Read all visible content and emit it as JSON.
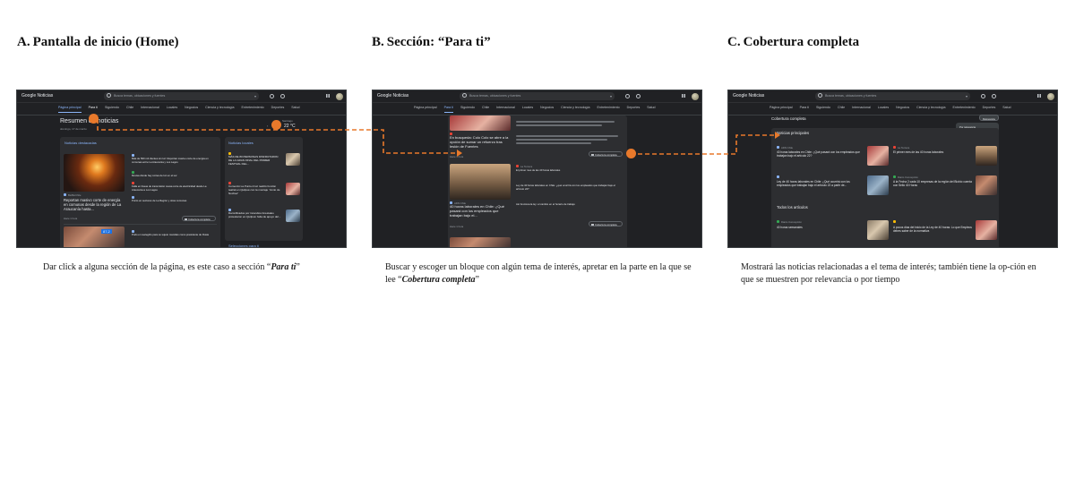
{
  "colors": {
    "accent_orange": "#e8792b",
    "screen_bg": "#202124",
    "link_blue": "#8ab4f8"
  },
  "panels": [
    {
      "letter": "A.",
      "title": "Pantalla de inicio (Home)",
      "caption_before": "Dar click a alguna sección de la página, es este caso a sección “",
      "caption_emph": "Para ti",
      "caption_after": "”"
    },
    {
      "letter": "B.",
      "title": "Sección: “Para ti”",
      "caption_before": "Buscar y escoger un bloque con algún tema de interés, apretar en la parte en la que se lee “",
      "caption_emph": "Cobertura completa",
      "caption_after": "”"
    },
    {
      "letter": "C.",
      "title": "Cobertura completa",
      "caption_before": "Mostrará las noticias relacionadas a el tema de interés; también tiene la op-ción en que se muestren por relevancia o por tiempo",
      "caption_emph": "",
      "caption_after": ""
    }
  ],
  "app": {
    "name": "Google Noticias",
    "search_placeholder": "Busca temas, ubicaciones y fuentes",
    "nav": [
      "Página principal",
      "Para ti",
      "Siguiendo",
      "Chile",
      "Internacional",
      "Locales",
      "Negocios",
      "Ciencia y tecnología",
      "Entretenimiento",
      "Deportes",
      "Salud"
    ]
  },
  "screen_a": {
    "heading": "Resumen de noticias",
    "date": "domingo, 17 de marzo",
    "weather_place": "Santiago",
    "temperature": "22 °C",
    "highlights": "Noticias destacadas",
    "local": "Noticias locales",
    "main_headline": "Reportan masivo corte de energía en comunas desde la región de La Araucanía hasta...",
    "main_source": "BioBioChile",
    "main_time": "Hace 1 hora",
    "full_coverage": "Cobertura completa",
    "badge": "87,2",
    "sections_label": "Selecciones para ti",
    "local_items": [
      "MÁS DE 80 PERSONAS DISFRUTARON DE LA GRAN FINAL DEL PRIMER FESTIVAL DEL...",
      "Comenzó La Punto-Cruz realizó función teatral en Quilpué con la montaje “Junto de Noches”",
      "Damnificados por incendios forestales protestaron en Quilpué: falta de apoyo del..."
    ],
    "side_items": [
      "Más de 500 mil clientes sin luz: Reportan masivo corte de energía en comunas entre La Araucanía y Los Lagos",
      "Revisa dónde hay cortes de luz en el sur",
      "Falla en líneas de transmisión causa corte de electricidad desde La Araucanía a Los Lagos",
      "Punto en sectores de La Región y otras comunas",
      "Pudo en reelegirlo para su sujeto mandato como presidente de Rusia"
    ]
  },
  "screen_b": {
    "headline_1": "En busqueda: Colo Colo se abre a la opción de sumar un refuerzo tras lesión de Fuentes",
    "headline_2": "40 horas laborales en Chile: ¿Qué pasará con los empleados que trabajan bajo el...",
    "source_1": "La Tercera",
    "source_2": "ADN Chile",
    "time": "Hace 1 hora",
    "full_coverage": "Cobertura completa",
    "side_items": [
      "El primer mes de las 40 horas laborales",
      "Ley de 40 horas laborales en Chile: ¿qué ocurrirá con los empleados que trabajan bajo el artículo 22?",
      "Así funciona la ley: el cambio en el horario de trabajo"
    ]
  },
  "screen_c": {
    "heading": "Cobertura completa",
    "top_news": "Noticias principales",
    "all_articles": "Todos los artículos",
    "sort_label": "Relevancia",
    "sort_options": [
      "Por relevancia",
      "Por fecha"
    ],
    "items": [
      "40 horas laborales en Chile: ¿Qué pasará con los empleados que trabajan bajo el artículo 22?",
      "El primer mes de las 40 horas laborales",
      "Ley de 40 horas laborales en Chile: ¿Qué ocurrirá con los empleados que trabajan bajo el artículo 22 a partir de...",
      "A la Fecha 2 cada 10 empresas de la región del Biobío cuenta con Sello 40 Horas",
      "40 horas semanales",
      "A pocos días del inicio de la Ley de 40 horas: Lo que Empleos debes saber de la normativa"
    ],
    "sources": [
      "ADN Chile",
      "La Tercera",
      "Diario Concepción"
    ]
  }
}
